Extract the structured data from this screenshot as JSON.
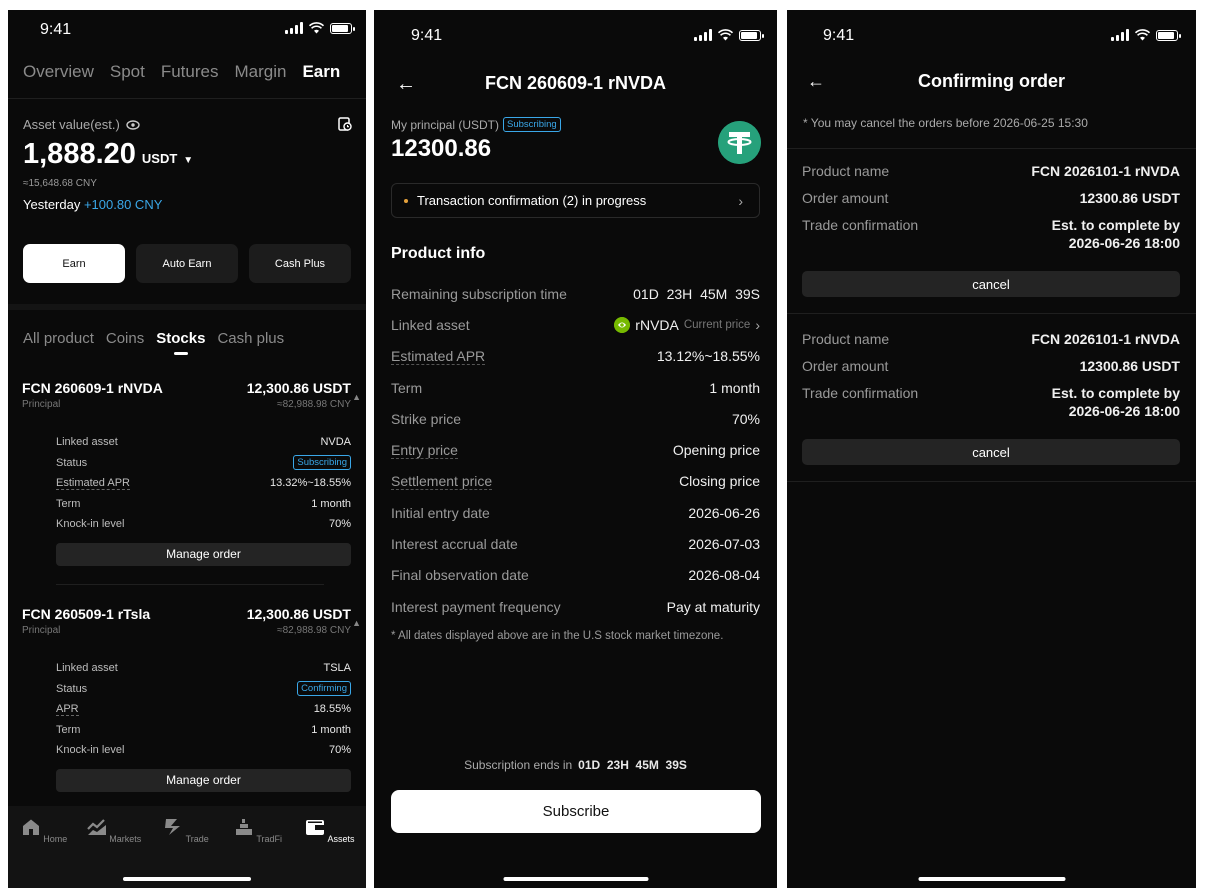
{
  "status": {
    "time": "9:41"
  },
  "screen1": {
    "top_tabs": [
      "Overview",
      "Spot",
      "Futures",
      "Margin",
      "Earn"
    ],
    "asset_label": "Asset value(est.)",
    "asset_value": "1,888.20",
    "asset_unit": "USDT",
    "asset_cny": "≈15,648.68 CNY",
    "yesterday_label": "Yesterday",
    "yesterday_value": "+100.80 CNY",
    "buttons": [
      "Earn",
      "Auto Earn",
      "Cash Plus"
    ],
    "cat_tabs": [
      "All product",
      "Coins",
      "Stocks",
      "Cash plus"
    ],
    "products": [
      {
        "name": "FCN 260609-1 rNVDA",
        "amount": "12,300.86 USDT",
        "principal": "Principal",
        "cny": "≈82,988.98 CNY",
        "rows": [
          {
            "k": "Linked asset",
            "v": "NVDA"
          },
          {
            "k": "Status",
            "v": "Subscribing"
          },
          {
            "k": "Estimated APR",
            "v": "13.32%~18.55%"
          },
          {
            "k": "Term",
            "v": "1 month"
          },
          {
            "k": "Knock-in level",
            "v": "70%"
          }
        ],
        "manage": "Manage order"
      },
      {
        "name": "FCN 260509-1 rTsla",
        "amount": "12,300.86 USDT",
        "principal": "Principal",
        "cny": "≈82,988.98 CNY",
        "rows": [
          {
            "k": "Linked asset",
            "v": "TSLA"
          },
          {
            "k": "Status",
            "v": "Confirming"
          },
          {
            "k": "APR",
            "v": "18.55%"
          },
          {
            "k": "Term",
            "v": "1 month"
          },
          {
            "k": "Knock-in level",
            "v": "70%"
          }
        ],
        "manage": "Manage order"
      }
    ],
    "tabbar": [
      "Home",
      "Markets",
      "Trade",
      "TradFi",
      "Assets"
    ]
  },
  "screen2": {
    "title": "FCN 260609-1 rNVDA",
    "principal_label": "My principal (USDT)",
    "principal_badge": "Subscribing",
    "principal_value": "12300.86",
    "tx_text": "Transaction confirmation (2) in progress",
    "section_title": "Product info",
    "info": [
      {
        "k": "Remaining subscription time",
        "v": "01D  23H  45M  39S"
      },
      {
        "k": "Linked asset",
        "v": "rNVDA",
        "extra": "Current price"
      },
      {
        "k": "Estimated APR",
        "v": "13.12%~18.55%"
      },
      {
        "k": "Term",
        "v": "1 month"
      },
      {
        "k": "Strike price",
        "v": "70%"
      },
      {
        "k": "Entry price",
        "v": "Opening price"
      },
      {
        "k": "Settlement price",
        "v": "Closing price"
      },
      {
        "k": "Initial entry date",
        "v": "2026-06-26"
      },
      {
        "k": "Interest accrual date",
        "v": "2026-07-03"
      },
      {
        "k": "Final observation date",
        "v": "2026-08-04"
      },
      {
        "k": "Interest payment frequency",
        "v": "Pay at maturity"
      }
    ],
    "note": "* All dates displayed above are in the U.S stock market timezone.",
    "ends_label": "Subscription ends in",
    "ends_value": "01D  23H  45M  39S",
    "subscribe": "Subscribe"
  },
  "screen3": {
    "title": "Confirming order",
    "note_prefix": "* You may cancel the orders before",
    "note_date": "2026-06-25 15:30",
    "orders": [
      {
        "product_label": "Product name",
        "product": "FCN 2026101-1 rNVDA",
        "amount_label": "Order amount",
        "amount": "12300.86 USDT",
        "trade_label": "Trade confirmation",
        "trade_line1": "Est. to complete by",
        "trade_line2": "2026-06-26 18:00",
        "cancel": "cancel"
      },
      {
        "product_label": "Product name",
        "product": "FCN 2026101-1 rNVDA",
        "amount_label": "Order amount",
        "amount": "12300.86 USDT",
        "trade_label": "Trade confirmation",
        "trade_line1": "Est. to complete by",
        "trade_line2": "2026-06-26 18:00",
        "cancel": "cancel"
      }
    ]
  }
}
